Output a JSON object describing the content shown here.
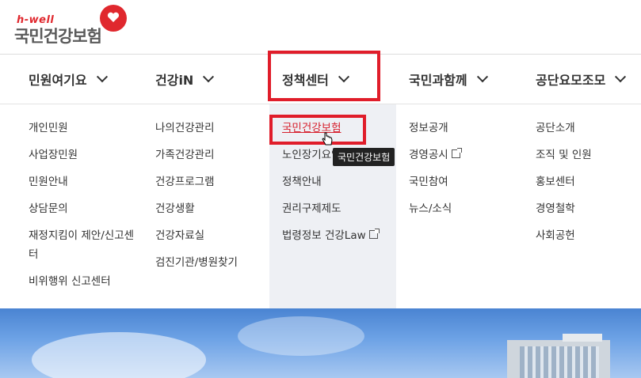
{
  "brand": {
    "small": "h-well",
    "name": "국민건강보험"
  },
  "gnb": [
    {
      "label": "민원여기요"
    },
    {
      "label": "건강iN"
    },
    {
      "label": "정책센터"
    },
    {
      "label": "국민과함께"
    },
    {
      "label": "공단요모조모"
    }
  ],
  "menu": {
    "col1": [
      "개인민원",
      "사업장민원",
      "민원안내",
      "상담문의",
      "재정지킴이 제안/신고센터",
      "비위행위 신고센터"
    ],
    "col2": [
      "나의건강관리",
      "가족건강관리",
      "건강프로그램",
      "건강생활",
      "건강자료실",
      "검진기관/병원찾기"
    ],
    "col3": [
      "국민건강보험",
      "노인장기요양",
      "정책안내",
      "권리구제제도",
      "법령정보 건강Law"
    ],
    "col4": [
      "정보공개",
      "경영공시",
      "국민참여",
      "뉴스/소식"
    ],
    "col5": [
      "공단소개",
      "조직 및 인원",
      "홍보센터",
      "경영철학",
      "사회공헌"
    ]
  },
  "tooltip": "국민건강보험",
  "colors": {
    "accent": "#e01d2a",
    "active_bg": "#eef0f4"
  },
  "icons": {
    "chevron": "chevron-down-icon",
    "external": "external-link-icon",
    "logo": "heart-logo-icon"
  }
}
